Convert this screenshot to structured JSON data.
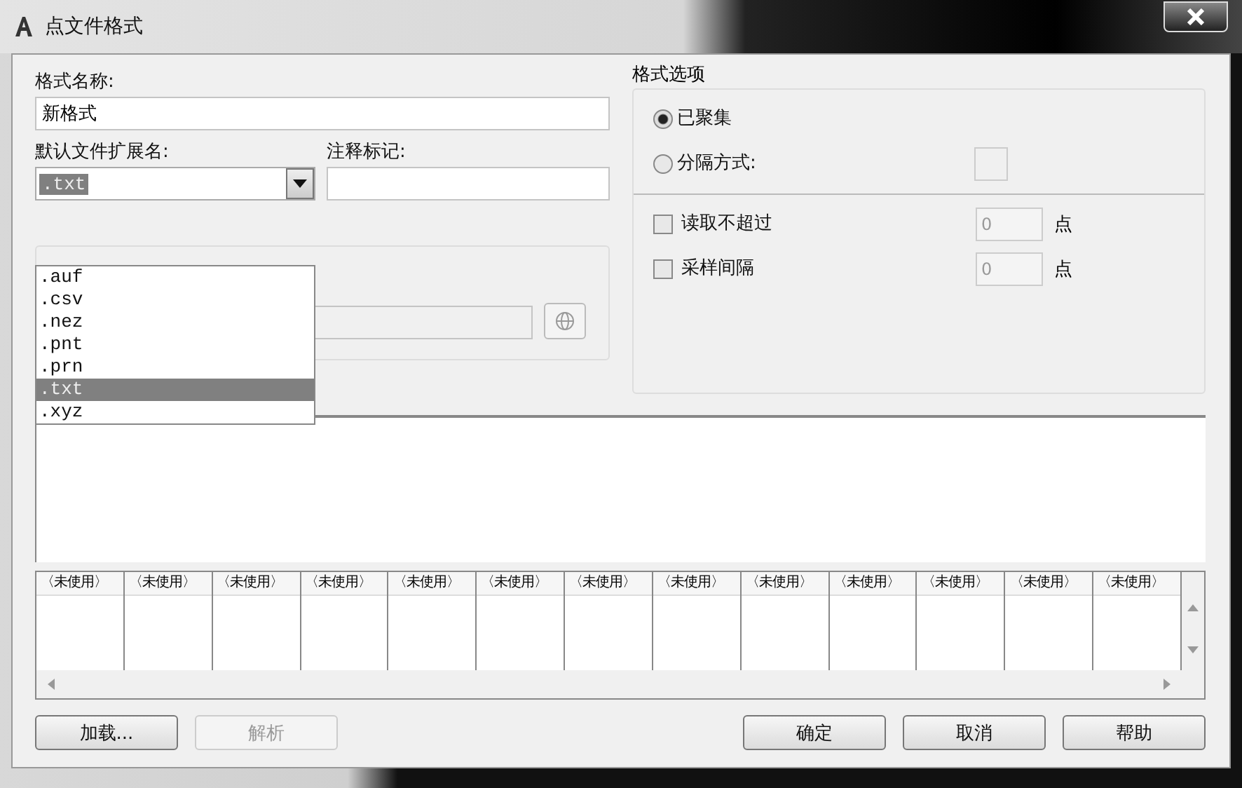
{
  "window": {
    "title": "点文件格式"
  },
  "format_name": {
    "label": "格式名称:",
    "value": "新格式"
  },
  "extension": {
    "label": "默认文件扩展名:",
    "value": ".txt",
    "expanded": true,
    "options": [
      {
        "label": ".auf",
        "selected": false
      },
      {
        "label": ".csv",
        "selected": false
      },
      {
        "label": ".nez",
        "selected": false
      },
      {
        "label": ".pnt",
        "selected": false
      },
      {
        "label": ".prn",
        "selected": false
      },
      {
        "label": ".txt",
        "selected": true
      },
      {
        "label": ".xyz",
        "selected": false
      }
    ]
  },
  "comment_marker": {
    "label": "注释标记:"
  },
  "hidden_group": {
    "field_disabled": true,
    "button_disabled": true
  },
  "format_options": {
    "title": "格式选项",
    "modes": [
      {
        "label": "已聚集",
        "selected": true
      },
      {
        "label": "分隔方式:",
        "selected": false
      }
    ],
    "delimiter_disabled": true,
    "limits": [
      {
        "label": "读取不超过",
        "checked": false,
        "value": "0",
        "unit": "点",
        "disabled": true
      },
      {
        "label": "采样间隔",
        "checked": false,
        "value": "0",
        "unit": "点",
        "disabled": true
      }
    ]
  },
  "grid": {
    "columns": [
      "〈未使用〉",
      "〈未使用〉",
      "〈未使用〉",
      "〈未使用〉",
      "〈未使用〉",
      "〈未使用〉",
      "〈未使用〉",
      "〈未使用〉",
      "〈未使用〉",
      "〈未使用〉",
      "〈未使用〉",
      "〈未使用〉",
      "〈未使用〉"
    ]
  },
  "buttons": [
    {
      "label": "加载...",
      "disabled": false
    },
    {
      "label": "解析",
      "disabled": true
    },
    {
      "label": "确定",
      "disabled": false
    },
    {
      "label": "取消",
      "disabled": false
    },
    {
      "label": "帮助",
      "disabled": false
    }
  ]
}
